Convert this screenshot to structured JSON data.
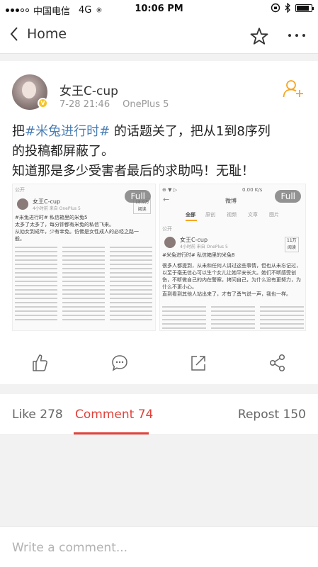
{
  "status_bar": {
    "carrier": "中国电信",
    "network": "4G",
    "time": "10:06 PM"
  },
  "nav": {
    "back_label": "Home"
  },
  "post": {
    "username": "女王C-cup",
    "date": "7-28 21:46",
    "device": "OnePlus 5",
    "text_line1_prefix": "把",
    "topic": "#米兔进行时#",
    "text_line1_suffix": " 的话题关了，把从1到8序列",
    "text_line2": "的投稿都屏蔽了。",
    "text_line3": "知道那是多少受害者最后的求助吗！无耻！",
    "images": [
      {
        "full_label": "Full",
        "visibility": "公开",
        "author": "女王C-cup",
        "time_source": "4小时前 来自 OnePlus 5",
        "count": "18.9万",
        "count_sub": "阅读",
        "topic_line": "#米兔进行时# 私信箱里的米兔5",
        "line1": "太多了太多了，每分钟都有米兔的私信飞来。",
        "line2": "从幼女到成年，少有幸免。仿佛是女性成人的必经之路一",
        "line3": "般。"
      },
      {
        "full_label": "Full",
        "net_speed": "0.00 K/s",
        "title": "微博",
        "tabs": [
          "全部",
          "原创",
          "视频",
          "文章",
          "图片"
        ],
        "visibility": "公开",
        "author": "女王C-cup",
        "time_source": "4小时前 来自 OnePlus 5",
        "count": "11万",
        "count_sub": "阅读",
        "topic_line": "#米兔进行时# 私信箱里的米兔8",
        "body": "很多人都提到，从未和任何人讲过这些事情，但也从未忘记过，以至于毫无信心可以生个女儿让她平安长大。她们不断感受创伤，不断做自己的内在警察，拷问自己，为什么没有更努力，为什么不更小心。",
        "body2": "直到看到其他人站出来了，才有了勇气说一声，我也一样。"
      }
    ]
  },
  "tabs": {
    "like": "Like 278",
    "comment": "Comment 74",
    "repost": "Repost 150"
  },
  "comment_input": {
    "placeholder": "Write a comment..."
  },
  "colors": {
    "accent": "#e2413a",
    "topic": "#4a7fb6",
    "follow": "#f5a623"
  }
}
